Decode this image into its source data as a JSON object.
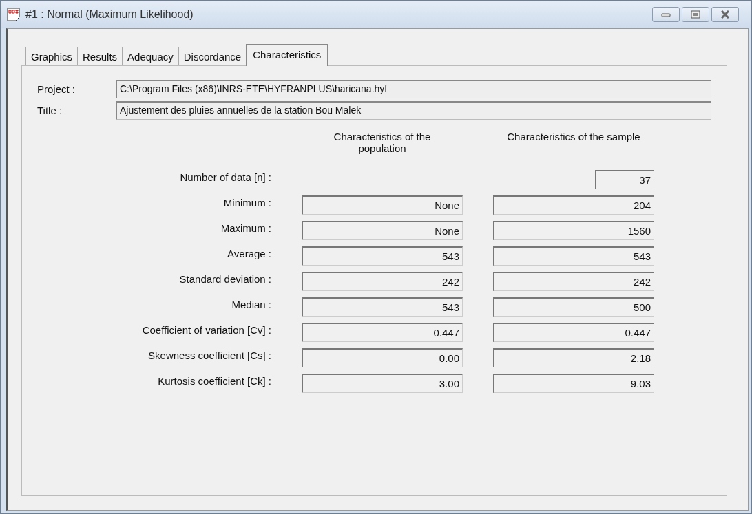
{
  "window": {
    "title": "#1 : Normal (Maximum Likelihood)"
  },
  "tabs": [
    {
      "label": "Graphics",
      "selected": false
    },
    {
      "label": "Results",
      "selected": false
    },
    {
      "label": "Adequacy",
      "selected": false
    },
    {
      "label": "Discordance",
      "selected": false
    },
    {
      "label": "Characteristics",
      "selected": true
    }
  ],
  "fields": [
    {
      "label": "Project :",
      "value": "C:\\Program Files (x86)\\INRS-ETE\\HYFRANPLUS\\haricana.hyf"
    },
    {
      "label": "Title :",
      "value": "Ajustement des pluies annuelles de la station Bou Malek"
    }
  ],
  "columns": [
    "Characteristics of the population",
    "Characteristics of the sample"
  ],
  "rows": [
    {
      "label": "Number of data [n] :",
      "sample": "37"
    },
    {
      "label": "Minimum :",
      "population": "None",
      "sample": "204"
    },
    {
      "label": "Maximum :",
      "population": "None",
      "sample": "1560"
    },
    {
      "label": "Average :",
      "population": "543",
      "sample": "543"
    },
    {
      "label": "Standard deviation :",
      "population": "242",
      "sample": "242"
    },
    {
      "label": "Median :",
      "population": "543",
      "sample": "500"
    },
    {
      "label": "Coefficient of variation [Cv] :",
      "population": "0.447",
      "sample": "0.447"
    },
    {
      "label": "Skewness coefficient [Cs] :",
      "population": "0.00",
      "sample": "2.18"
    },
    {
      "label": "Kurtosis coefficient [Ck] :",
      "population": "3.00",
      "sample": "9.03"
    }
  ]
}
